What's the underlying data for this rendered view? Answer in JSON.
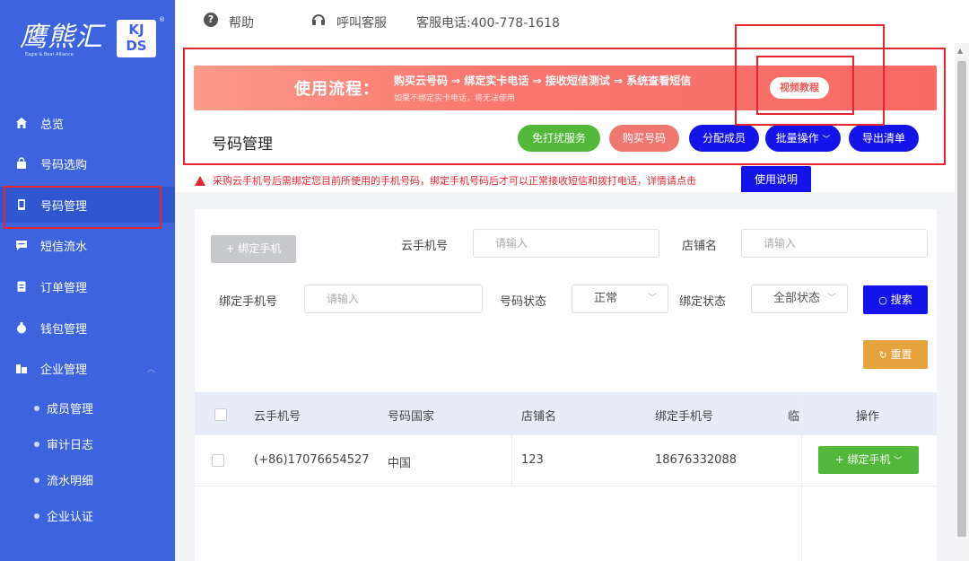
{
  "logo": {
    "text": "鹰熊汇",
    "sub": "Eagle & Bear Alliance",
    "badge": "KJ DS",
    "reg": "®"
  },
  "sidebar": {
    "items": [
      {
        "label": "总览"
      },
      {
        "label": "号码选购"
      },
      {
        "label": "号码管理"
      },
      {
        "label": "短信流水"
      },
      {
        "label": "订单管理"
      },
      {
        "label": "钱包管理"
      },
      {
        "label": "企业管理"
      }
    ],
    "subitems": [
      {
        "label": "成员管理"
      },
      {
        "label": "审计日志"
      },
      {
        "label": "流水明细"
      },
      {
        "label": "企业认证"
      }
    ]
  },
  "topbar": {
    "help": "帮助",
    "cs": "呼叫客服",
    "phone": "客服电话:400-778-1618"
  },
  "banner": {
    "title": "使用流程：",
    "steps": "购买云号码 ⇒ 绑定实卡电话 ⇒ 接收短信测试 ⇒ 系统查看短信",
    "note": "如果不绑定实卡电话，将无法使用",
    "video_btn": "视频教程"
  },
  "page_title": "号码管理",
  "actions": {
    "no_disturb": "免打扰服务",
    "buy": "购买号码",
    "assign": "分配成员",
    "batch": "批量操作",
    "export": "导出清单"
  },
  "warning": {
    "text": "采购云手机号后需绑定您目前所使用的手机号码，绑定手机号码后才可以正常接收短信和拨打电话，详情请点击",
    "btn": "使用说明"
  },
  "filters": {
    "bind_btn": "+ 绑定手机",
    "cloud_phone_label": "云手机号",
    "cloud_phone_placeholder": "请输入",
    "shop_label": "店铺名",
    "shop_placeholder": "请输入",
    "bind_phone_label": "绑定手机号",
    "bind_phone_placeholder": "请输入",
    "status_label": "号码状态",
    "status_value": "正常",
    "bind_status_label": "绑定状态",
    "bind_status_value": "全部状态",
    "search_btn": "搜索",
    "reset_btn": "重置"
  },
  "table": {
    "headers": [
      "云手机号",
      "号码国家",
      "店铺名",
      "绑定手机号",
      "临",
      "操作"
    ],
    "rows": [
      {
        "cloud": "(+86)17076654527",
        "country": "中国",
        "shop": "123",
        "bound": "18676332088",
        "action": "+ 绑定手机"
      }
    ]
  },
  "colors": {
    "sidebar": "#3d63de",
    "primary": "#1414ea",
    "green": "#52b83a",
    "red": "#e8242e",
    "orange": "#e6a23c"
  }
}
